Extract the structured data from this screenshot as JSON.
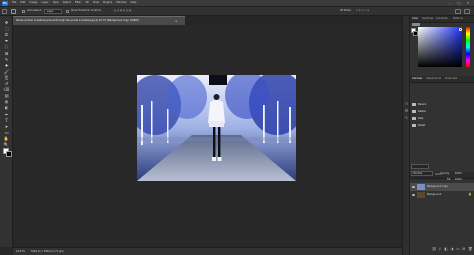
{
  "app": {
    "logo": "Ps",
    "menus": [
      "File",
      "Edit",
      "Image",
      "Layer",
      "Type",
      "Select",
      "Filter",
      "3D",
      "View",
      "Plugins",
      "Window",
      "Help"
    ],
    "window_controls": [
      "–",
      "□",
      "✕"
    ]
  },
  "options_bar": {
    "home_icon": "home-icon",
    "tool_icon": "move-tool-icon",
    "auto_select_label": "Auto-Select:",
    "auto_select_value": "Layer",
    "transform_label": "Show Transform Controls",
    "mode_label": "3D Mode:"
  },
  "document": {
    "tab_title": "Teenie woman is walking around through the woods inverted.jpeg @ 16.7% (Background copy, RGB/8)",
    "close_glyph": "×"
  },
  "toolbar": {
    "tools": [
      "move-icon",
      "marquee-icon",
      "lasso-icon",
      "quick-select-icon",
      "crop-icon",
      "frame-icon",
      "eyedropper-icon",
      "healing-icon",
      "brush-icon",
      "clone-stamp-icon",
      "history-brush-icon",
      "eraser-icon",
      "gradient-icon",
      "blur-icon",
      "dodge-icon",
      "pen-icon",
      "type-icon",
      "path-select-icon",
      "rectangle-icon",
      "hand-icon",
      "zoom-icon",
      "more-icon"
    ],
    "tool_glyphs": [
      "✥",
      "⬚",
      "ᘏ",
      "⌯",
      "⛶",
      "⊠",
      "✎",
      "✚",
      "🖌",
      "⎗",
      "↺",
      "⌫",
      "▤",
      "◍",
      "◐",
      "✒",
      "T",
      "➤",
      "▭",
      "✋",
      "🔍",
      "…"
    ],
    "fg_color": "#ffffff",
    "bg_color": "#000000"
  },
  "status_bar": {
    "zoom": "16.67%",
    "doc_info": "5464 px x 3640 px (72 ppi)"
  },
  "panels": {
    "color_tabs": [
      "Color",
      "Swatches",
      "Gradients",
      "Patterns"
    ],
    "color_tab_active": "Color",
    "adjust_tabs": [
      "Libraries",
      "Adjustments",
      "Properties"
    ],
    "adjust_tab_active": "Libraries",
    "library_folders": [
      "Basics",
      "Pastel",
      "Pale",
      "Pallet"
    ],
    "layers_tabs": [
      "Layers",
      "Channels",
      "Paths"
    ],
    "layers_tab_active": "Layers",
    "blend_mode": "Normal",
    "opacity_label": "Opacity:",
    "opacity_value": "100%",
    "fill_label": "Fill:",
    "fill_value": "100%",
    "layers": [
      {
        "name": "Background copy",
        "selected": true
      },
      {
        "name": "Background",
        "selected": false,
        "locked": true
      }
    ],
    "lock_glyph": "🔒"
  },
  "accent_color": "#1473e6",
  "selected_color": "#1d33ff"
}
